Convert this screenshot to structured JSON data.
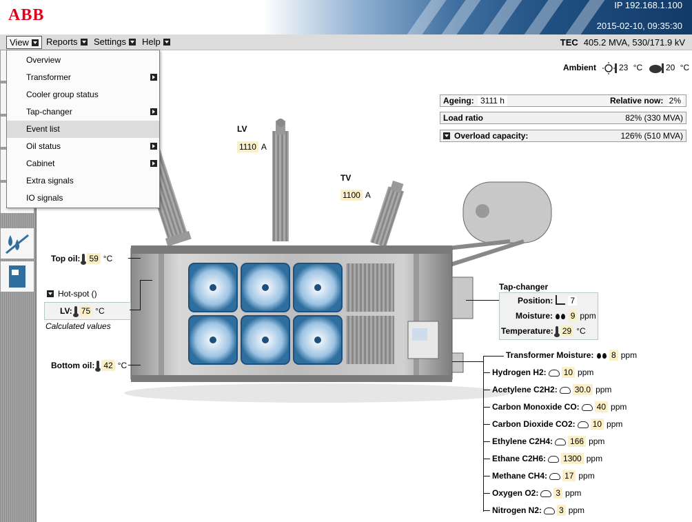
{
  "header": {
    "logo": "ABB",
    "ip": "IP 192.168.1.100",
    "datetime": "2015-02-10, 09:35:30"
  },
  "menubar": {
    "menus": [
      {
        "label": "View"
      },
      {
        "label": "Reports"
      },
      {
        "label": "Settings"
      },
      {
        "label": "Help"
      }
    ],
    "tec_label": "TEC",
    "tec_value": "405.2 MVA, 530/171.9 kV"
  },
  "view_menu": {
    "items": [
      {
        "label": "Overview",
        "submenu": false
      },
      {
        "label": "Transformer",
        "submenu": true
      },
      {
        "label": "Cooler group status",
        "submenu": false
      },
      {
        "label": "Tap-changer",
        "submenu": true
      },
      {
        "label": "Event list",
        "submenu": false,
        "selected": true
      },
      {
        "label": "Oil status",
        "submenu": true
      },
      {
        "label": "Cabinet",
        "submenu": true
      },
      {
        "label": "Extra signals",
        "submenu": false
      },
      {
        "label": "IO signals",
        "submenu": false
      }
    ]
  },
  "ambient": {
    "label": "Ambient",
    "sun_value": "23",
    "sun_unit": "°C",
    "cloud_value": "20",
    "cloud_unit": "°C"
  },
  "info_panel": {
    "ageing_label": "Ageing:",
    "ageing_value": "3111 h",
    "relative_label": "Relative now:",
    "relative_value": "2%",
    "load_label": "Load ratio",
    "load_value": "82% (330 MVA)",
    "overload_label": "Overload capacity:",
    "overload_value": "126% (510 MVA)"
  },
  "bushings": {
    "lv_label": "LV",
    "lv_value": "1110",
    "lv_unit": "A",
    "tv_label": "TV",
    "tv_value": "1100",
    "tv_unit": "A"
  },
  "oil": {
    "top_label": "Top oil:",
    "top_value": "59",
    "top_unit": "°C",
    "hotspot_label": "Hot-spot ()",
    "hotspot_lv_label": "LV:",
    "hotspot_lv_value": "75",
    "hotspot_lv_unit": "°C",
    "calculated": "Calculated values",
    "bottom_label": "Bottom oil:",
    "bottom_value": "42",
    "bottom_unit": "°C"
  },
  "tap_changer": {
    "title": "Tap-changer",
    "position_label": "Position:",
    "position_value": "7",
    "moisture_label": "Moisture:",
    "moisture_value": "9",
    "moisture_unit": "ppm",
    "temperature_label": "Temperature:",
    "temperature_value": "29",
    "temperature_unit": "°C"
  },
  "gases": {
    "moisture_label": "Transformer Moisture:",
    "moisture_value": "8",
    "moisture_unit": "ppm",
    "items": [
      {
        "label": "Hydrogen H2:",
        "value": "10",
        "unit": "ppm"
      },
      {
        "label": "Acetylene C2H2:",
        "value": "30.0",
        "unit": "ppm"
      },
      {
        "label": "Carbon Monoxide CO:",
        "value": "40",
        "unit": "ppm"
      },
      {
        "label": "Carbon Dioxide CO2:",
        "value": "10",
        "unit": "ppm"
      },
      {
        "label": "Ethylene C2H4:",
        "value": "166",
        "unit": "ppm"
      },
      {
        "label": "Ethane C2H6:",
        "value": "1300",
        "unit": "ppm"
      },
      {
        "label": "Methane CH4:",
        "value": "17",
        "unit": "ppm"
      },
      {
        "label": "Oxygen O2:",
        "value": "3",
        "unit": "ppm"
      },
      {
        "label": "Nitrogen N2:",
        "value": "3",
        "unit": "ppm"
      }
    ]
  },
  "colors": {
    "value_bg": "#fbefc7",
    "abb_red": "#e2001a",
    "fan_blue": "#2f6f9f"
  }
}
